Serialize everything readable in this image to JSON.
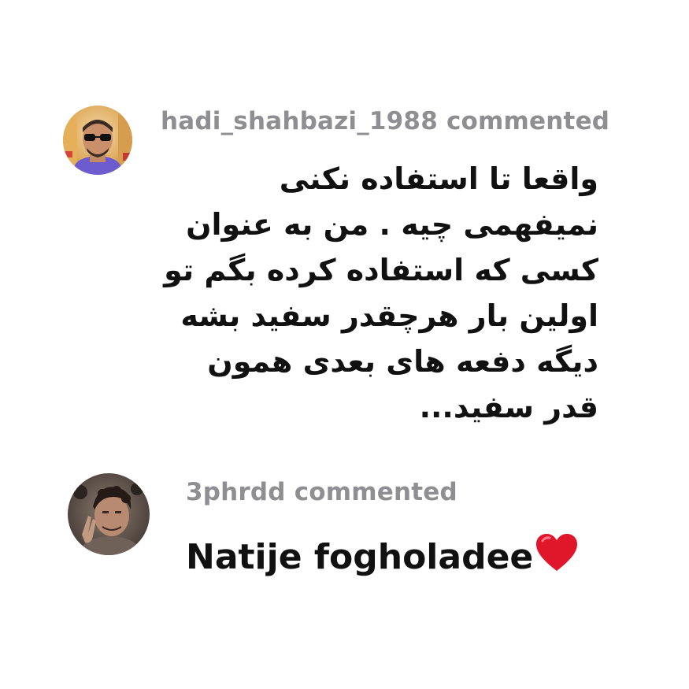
{
  "comments": [
    {
      "username": "hadi_shahbazi_1988",
      "action": "commented",
      "text": "واقعا تا استفاده نکنی نمیفهمی چیه . من به عنوان کسی که استفاده کرده بگم تو اولین بار هرچقدر سفید بشه دیگه دفعه های بعدی همون قدر سفید...",
      "avatar_icon": "user-photo-avatar"
    },
    {
      "username": "3phrdd",
      "action": "commented",
      "text": "Natije fogholadee",
      "emoji_icon": "red-heart-icon",
      "avatar_icon": "user-photo-avatar"
    }
  ]
}
